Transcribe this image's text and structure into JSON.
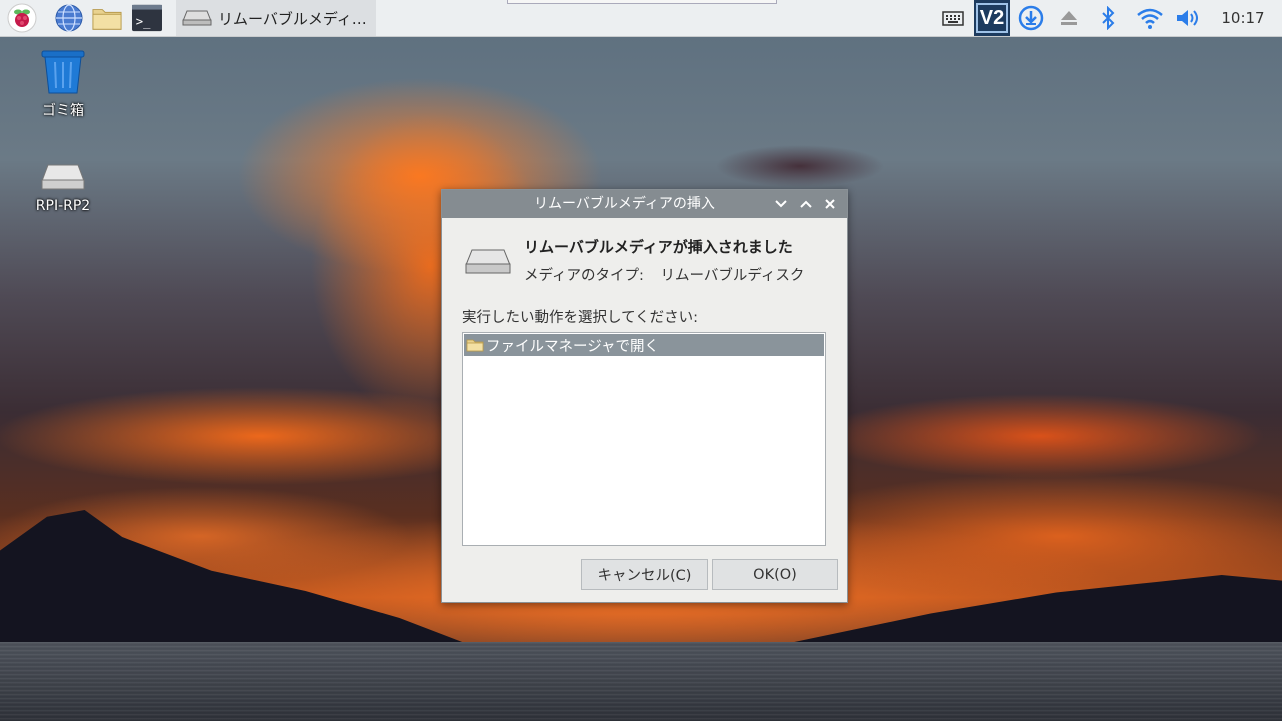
{
  "taskbar": {
    "task_title": "リムーバブルメディ…",
    "clock": "10:17",
    "vnc_label": "V2",
    "icons": [
      "raspberry-pi-menu-icon",
      "web-browser-icon",
      "file-manager-icon",
      "terminal-icon",
      "keyboard-icon",
      "vnc-icon",
      "download-icon",
      "eject-icon",
      "bluetooth-icon",
      "wifi-icon",
      "volume-icon"
    ]
  },
  "desktop": {
    "icons": [
      {
        "label": "ゴミ箱",
        "icon": "trash-icon"
      },
      {
        "label": "RPI-RP2",
        "icon": "drive-icon"
      }
    ]
  },
  "dialog": {
    "title": "リムーバブルメディアの挿入",
    "heading": "リムーバブルメディアが挿入されました",
    "media_type_label": "メディアのタイプ:",
    "media_type_value": "リムーバブルディスク",
    "prompt": "実行したい動作を選択してください:",
    "actions": [
      {
        "label": "ファイルマネージャで開く",
        "selected": true,
        "icon": "folder-icon"
      }
    ],
    "cancel_label": "キャンセル(C)",
    "ok_label": "OK(O)"
  },
  "colors": {
    "taskbar_bg": "#eceff1",
    "titlebar_bg": "#858c91",
    "selection_bg": "#8a949b",
    "dialog_bg": "#eeeeec"
  }
}
